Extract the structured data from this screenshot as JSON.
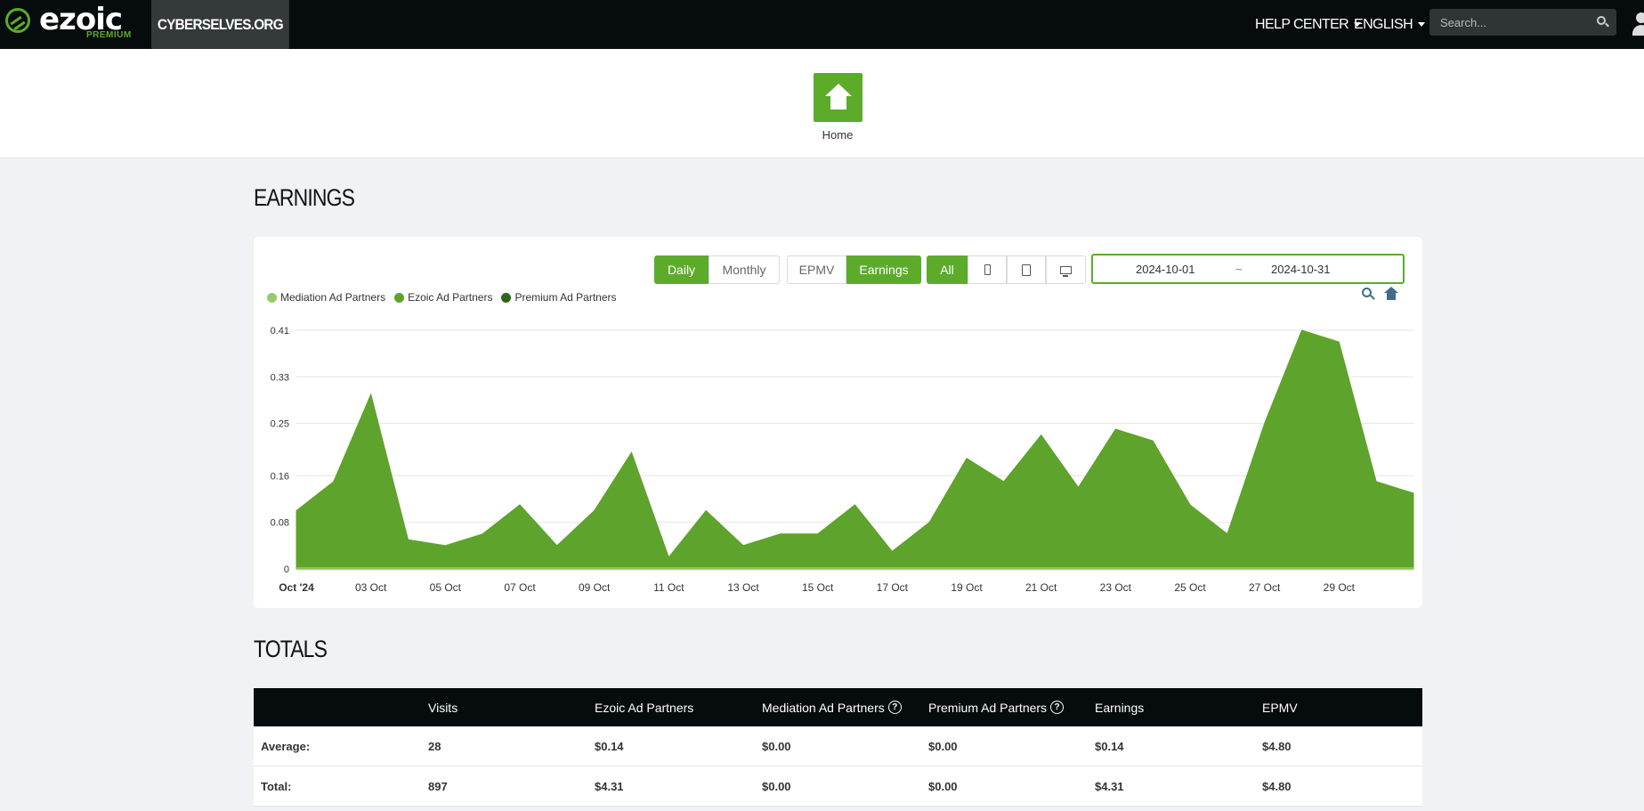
{
  "nav": {
    "logo_text": "ezoic",
    "logo_sub": "PREMIUM",
    "site_name": "CYBERSELVES.ORG",
    "help_center": "HELP CENTER",
    "language": "ENGLISH",
    "search_placeholder": "Search..."
  },
  "home": {
    "label": "Home"
  },
  "earnings": {
    "title": "EARNINGS",
    "period_buttons": [
      "Daily",
      "Monthly"
    ],
    "period_active": "Daily",
    "metric_buttons": [
      "EPMV",
      "Earnings"
    ],
    "metric_active": "Earnings",
    "device_all": "All",
    "date_from": "2024-10-01",
    "date_sep": "~",
    "date_to": "2024-10-31",
    "legend": [
      {
        "label": "Mediation Ad Partners",
        "color": "#97cc6b"
      },
      {
        "label": "Ezoic Ad Partners",
        "color": "#5ea32b"
      },
      {
        "label": "Premium Ad Partners",
        "color": "#2f6516"
      }
    ]
  },
  "chart_data": {
    "type": "area",
    "title": "",
    "xlabel": "",
    "ylabel": "",
    "ylim": [
      0,
      0.41
    ],
    "yticks": [
      0,
      0.08,
      0.16,
      0.25,
      0.33,
      0.41
    ],
    "x": [
      "2024-10-01",
      "2024-10-02",
      "2024-10-03",
      "2024-10-04",
      "2024-10-05",
      "2024-10-06",
      "2024-10-07",
      "2024-10-08",
      "2024-10-09",
      "2024-10-10",
      "2024-10-11",
      "2024-10-12",
      "2024-10-13",
      "2024-10-14",
      "2024-10-15",
      "2024-10-16",
      "2024-10-17",
      "2024-10-18",
      "2024-10-19",
      "2024-10-20",
      "2024-10-21",
      "2024-10-22",
      "2024-10-23",
      "2024-10-24",
      "2024-10-25",
      "2024-10-26",
      "2024-10-27",
      "2024-10-28",
      "2024-10-29",
      "2024-10-30",
      "2024-10-31"
    ],
    "xtick_labels": [
      "Oct '24",
      "03 Oct",
      "05 Oct",
      "07 Oct",
      "09 Oct",
      "11 Oct",
      "13 Oct",
      "15 Oct",
      "17 Oct",
      "19 Oct",
      "21 Oct",
      "23 Oct",
      "25 Oct",
      "27 Oct",
      "29 Oct"
    ],
    "series": [
      {
        "name": "Ezoic Ad Partners",
        "color": "#5ea32b",
        "values": [
          0.1,
          0.15,
          0.3,
          0.05,
          0.04,
          0.06,
          0.11,
          0.04,
          0.1,
          0.2,
          0.02,
          0.1,
          0.04,
          0.06,
          0.06,
          0.11,
          0.03,
          0.08,
          0.19,
          0.15,
          0.23,
          0.14,
          0.24,
          0.22,
          0.11,
          0.06,
          0.25,
          0.41,
          0.39,
          0.15,
          0.13
        ]
      }
    ],
    "grid": true,
    "legend_position": "top-left"
  },
  "totals": {
    "title": "TOTALS",
    "columns": [
      "",
      "Visits",
      "Ezoic Ad Partners",
      "Mediation Ad Partners",
      "Premium Ad Partners",
      "Earnings",
      "EPMV"
    ],
    "rows": [
      [
        "Average:",
        "28",
        "$0.14",
        "$0.00",
        "$0.00",
        "$0.14",
        "$4.80"
      ],
      [
        "Total:",
        "897",
        "$4.31",
        "$0.00",
        "$0.00",
        "$4.31",
        "$4.80"
      ]
    ]
  },
  "colors": {
    "accent": "#5cab2b",
    "nav_bg": "#060b0d"
  }
}
